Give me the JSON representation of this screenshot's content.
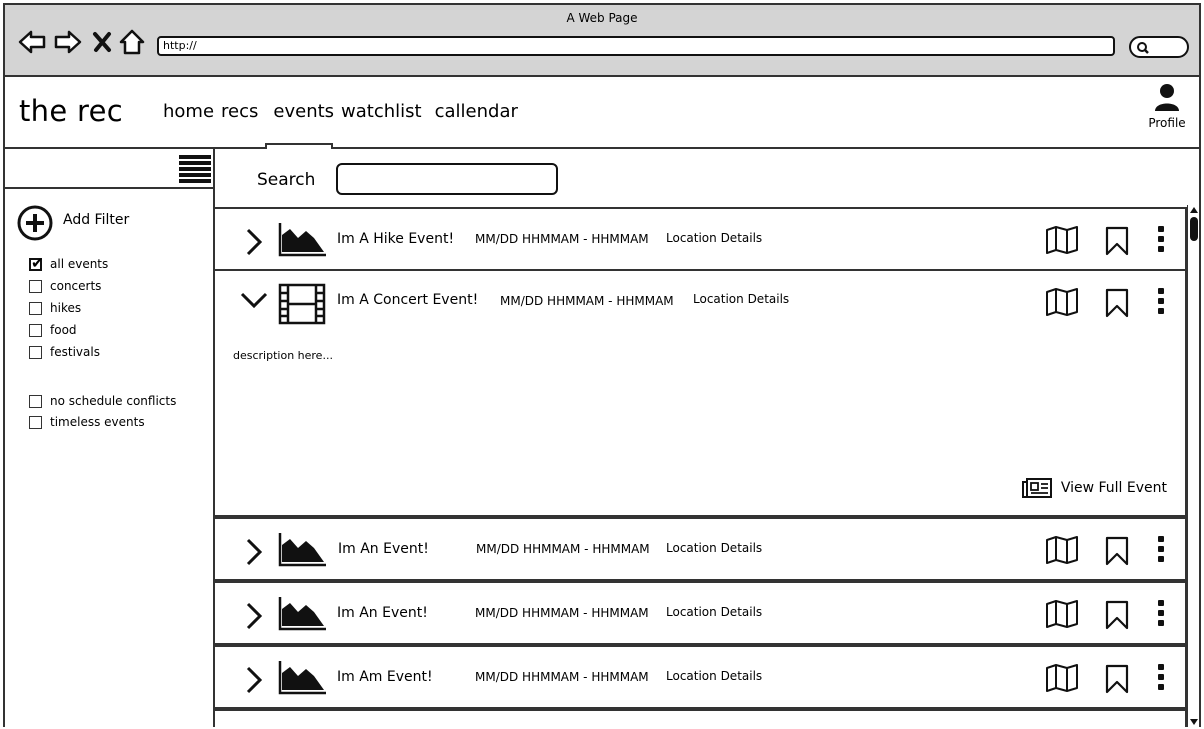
{
  "window": {
    "title": "A Web Page",
    "url": "http://"
  },
  "app": {
    "brand": "the rec",
    "profile_label": "Profile"
  },
  "nav": [
    {
      "label": "home",
      "active": false
    },
    {
      "label": "recs",
      "active": false
    },
    {
      "label": "events",
      "active": true
    },
    {
      "label": "watchlist",
      "active": false
    },
    {
      "label": "callendar",
      "active": false
    }
  ],
  "sidebar": {
    "add_filter_label": "Add Filter",
    "filters": [
      {
        "label": "all events",
        "checked": true
      },
      {
        "label": "concerts",
        "checked": false
      },
      {
        "label": "hikes",
        "checked": false
      },
      {
        "label": "food",
        "checked": false
      },
      {
        "label": "festivals",
        "checked": false
      }
    ],
    "options": [
      {
        "label": "no schedule conflicts",
        "checked": false
      },
      {
        "label": "timeless events",
        "checked": false
      }
    ]
  },
  "search": {
    "label": "Search",
    "value": ""
  },
  "events": [
    {
      "title": "Im A Hike Event!",
      "time": "MM/DD HHMMAM - HHMMAM",
      "location": "Location Details",
      "icon": "mountain-icon",
      "expanded": false
    },
    {
      "title": "Im A Concert Event!",
      "time": "MM/DD HHMMAM - HHMMAM",
      "location": "Location Details",
      "icon": "film-icon",
      "expanded": true,
      "description": "description here...",
      "view_full_label": "View Full Event"
    },
    {
      "title": "Im An Event!",
      "time": "MM/DD HHMMAM - HHMMAM",
      "location": "Location Details",
      "icon": "mountain-icon",
      "expanded": false
    },
    {
      "title": "Im An Event!",
      "time": "MM/DD HHMMAM - HHMMAM",
      "location": "Location Details",
      "icon": "mountain-icon",
      "expanded": false
    },
    {
      "title": "Im Am Event!",
      "time": "MM/DD HHMMAM - HHMMAM",
      "location": "Location Details",
      "icon": "mountain-icon",
      "expanded": false
    }
  ]
}
